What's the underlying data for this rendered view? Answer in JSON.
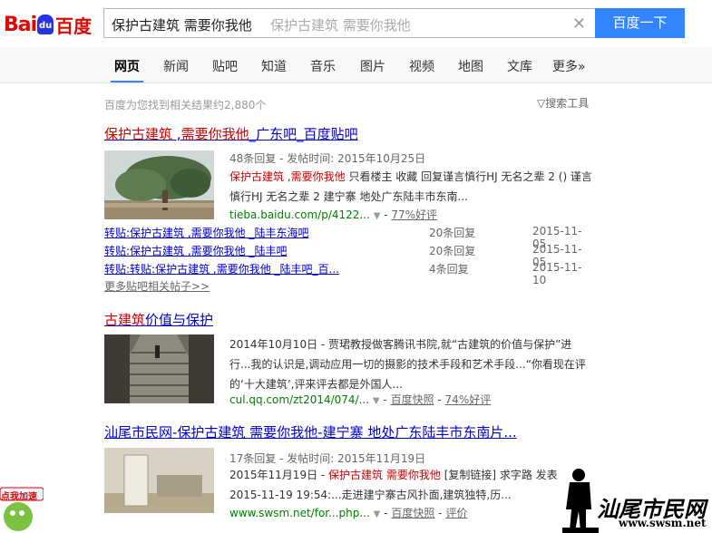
{
  "header": {
    "logo_bai": "Bai",
    "logo_du": "du",
    "logo_cn": "百度",
    "query": "保护古建筑 需要你我他",
    "ghost": "保护古建筑 需要你我他",
    "search_button": "百度一下"
  },
  "tabs": [
    "网页",
    "新闻",
    "贴吧",
    "知道",
    "音乐",
    "图片",
    "视频",
    "地图",
    "文库",
    "更多»"
  ],
  "stats": "百度为您找到相关结果约2,880个",
  "tools": "▽搜索工具",
  "r1": {
    "title_a": "保护古建筑",
    "title_b": " ,",
    "title_c": "需要你我他",
    "title_d": "_广东吧_百度贴吧",
    "meta": "48条回复 - 发帖时间: 2015年10月25日",
    "snip_a": "保护古建筑",
    "snip_b": " ,",
    "snip_c": "需要你我他",
    "snip_d": " 只看楼主 收藏 回复谨言慎行HJ 无名之辈 2 () 谨言慎行HJ 无名之辈 2 建宁寨 地处广东陆丰市东南...",
    "url": "tieba.baidu.com/p/4122...",
    "rating": "77%好评",
    "subs": [
      {
        "title": "转贴:保护古建筑 ,需要你我他 _陆丰东海吧",
        "count": "20条回复",
        "date": "2015-11-05"
      },
      {
        "title": "转贴:保护古建筑 ,需要你我他 _陆丰吧",
        "count": "20条回复",
        "date": "2015-11-05"
      },
      {
        "title": "转贴:转贴:保护古建筑 ,需要你我他 _陆丰吧_百...",
        "count": "4条回复",
        "date": "2015-11-10"
      }
    ],
    "more": "更多贴吧相关帖子>>"
  },
  "r2": {
    "title_a": "古建筑",
    "title_b": "价值与保护",
    "snip": "2014年10月10日 - 贾珺教授做客腾讯书院,就“古建筑的价值与保护”进行...我的认识是,调动应用一切的摄影的技术手段和艺术手段...“你看现在评的‘十大建筑’,评来评去都是外国人...",
    "url": "cul.qq.com/zt2014/074/...",
    "snapshot": "百度快照",
    "rating": "74%好评"
  },
  "r3": {
    "title": "汕尾市民网-保护古建筑 需要你我他-建宁寨 地处广东陆丰市东南片...",
    "meta": "17条回复 - 发帖时间: 2015年11月19日",
    "snip_date": "2015年11月19日 - ",
    "snip_a": "保护古建筑 需要你我他",
    "snip_b": " [复制链接] 求字路 发表",
    "snip_line2": "2015-11-19 19:54:...走进建宁寨古风扑面,建筑独特,历...",
    "url": "www.swsm.net/for...php...",
    "snapshot": "百度快照",
    "review": "评价"
  },
  "watermark": {
    "site_cn": "汕尾市民网",
    "site_url": "www.swsm.net"
  },
  "promo": "点我加速"
}
